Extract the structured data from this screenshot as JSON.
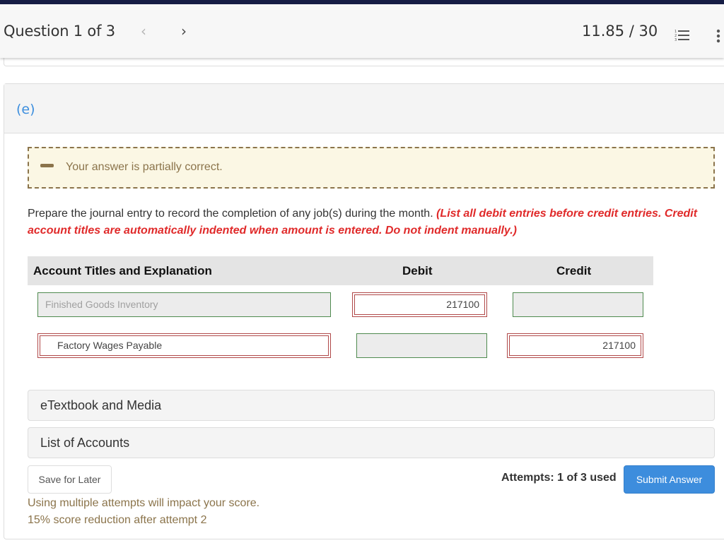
{
  "header": {
    "question_label": "Question 1 of 3",
    "prev_icon": "chevron-left-icon",
    "prev_glyph": "‹",
    "next_icon": "chevron-right-icon",
    "next_glyph": "›",
    "score": "11.85 / 30",
    "list_icon": "numbered-list-icon",
    "more_icon": "more-vertical-icon",
    "bar_color": "#161d45"
  },
  "part": {
    "label": "(e)",
    "label_color": "#3c8ede"
  },
  "feedback": {
    "icon": "partial-minus-icon",
    "text": "Your answer is partially correct.",
    "color": "#8b744b"
  },
  "instructions": {
    "main": "Prepare the journal entry to record the completion of any job(s) during the month. ",
    "emphasis": "(List all debit entries before credit entries. Credit account titles are automatically indented when amount is entered. Do not indent manually.)",
    "emphasis_color": "#e02a2a"
  },
  "journal": {
    "headers": {
      "account": "Account Titles and Explanation",
      "debit": "Debit",
      "credit": "Credit"
    },
    "rows": [
      {
        "account": "Finished Goods Inventory",
        "account_status": "correct",
        "debit": "217100",
        "debit_status": "incorrect",
        "credit": "",
        "credit_status": "correct"
      },
      {
        "account": "Factory Wages Payable",
        "account_status": "incorrect",
        "debit": "",
        "debit_status": "correct",
        "credit": "217100",
        "credit_status": "incorrect"
      }
    ]
  },
  "resources": {
    "etextbook": "eTextbook and Media",
    "accounts_list": "List of Accounts"
  },
  "footer": {
    "save_label": "Save for Later",
    "warning_line1": "Using multiple attempts will impact your score.",
    "warning_line2": "15% score reduction after attempt 2",
    "attempts": "Attempts: 1 of 3 used",
    "submit_label": "Submit Answer",
    "submit_color": "#3d8ddd"
  }
}
